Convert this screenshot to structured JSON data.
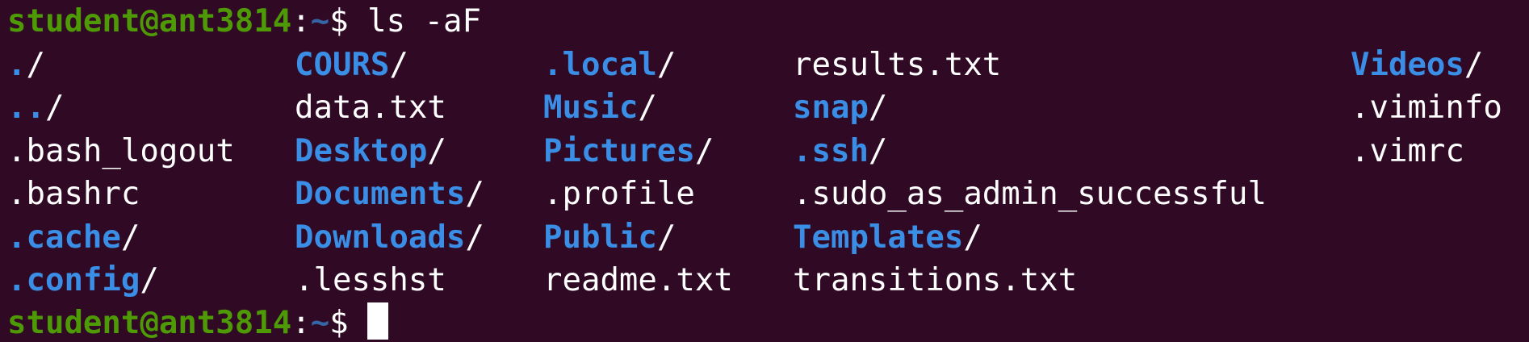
{
  "colors": {
    "background": "#300a24",
    "user_host": "#4e9a06",
    "path": "#3465a4",
    "directory": "#3a8ee6",
    "text": "#ffffff"
  },
  "prompt1": {
    "user_host": "student@ant3814",
    "sep": ":",
    "path": "~",
    "symbol": "$ ",
    "command": "ls -aF"
  },
  "listing": {
    "rows": [
      [
        {
          "name": ".",
          "suffix": "/",
          "type": "dir"
        },
        {
          "name": "COURS",
          "suffix": "/",
          "type": "dir"
        },
        {
          "name": ".local",
          "suffix": "/",
          "type": "dir"
        },
        {
          "name": "results.txt",
          "suffix": "",
          "type": "file"
        },
        {
          "name": "Videos",
          "suffix": "/",
          "type": "dir"
        }
      ],
      [
        {
          "name": "..",
          "suffix": "/",
          "type": "dir"
        },
        {
          "name": "data.txt",
          "suffix": "",
          "type": "file"
        },
        {
          "name": "Music",
          "suffix": "/",
          "type": "dir"
        },
        {
          "name": "snap",
          "suffix": "/",
          "type": "dir"
        },
        {
          "name": ".viminfo",
          "suffix": "",
          "type": "file"
        }
      ],
      [
        {
          "name": ".bash_logout",
          "suffix": "",
          "type": "file"
        },
        {
          "name": "Desktop",
          "suffix": "/",
          "type": "dir"
        },
        {
          "name": "Pictures",
          "suffix": "/",
          "type": "dir"
        },
        {
          "name": ".ssh",
          "suffix": "/",
          "type": "dir"
        },
        {
          "name": ".vimrc",
          "suffix": "",
          "type": "file"
        }
      ],
      [
        {
          "name": ".bashrc",
          "suffix": "",
          "type": "file"
        },
        {
          "name": "Documents",
          "suffix": "/",
          "type": "dir"
        },
        {
          "name": ".profile",
          "suffix": "",
          "type": "file"
        },
        {
          "name": ".sudo_as_admin_successful",
          "suffix": "",
          "type": "file"
        },
        null
      ],
      [
        {
          "name": ".cache",
          "suffix": "/",
          "type": "dir"
        },
        {
          "name": "Downloads",
          "suffix": "/",
          "type": "dir"
        },
        {
          "name": "Public",
          "suffix": "/",
          "type": "dir"
        },
        {
          "name": "Templates",
          "suffix": "/",
          "type": "dir"
        },
        null
      ],
      [
        {
          "name": ".config",
          "suffix": "/",
          "type": "dir"
        },
        {
          "name": ".lesshst",
          "suffix": "",
          "type": "file"
        },
        {
          "name": "readme.txt",
          "suffix": "",
          "type": "file"
        },
        {
          "name": "transitions.txt",
          "suffix": "",
          "type": "file"
        },
        null
      ]
    ]
  },
  "prompt2": {
    "user_host": "student@ant3814",
    "sep": ":",
    "path": "~",
    "symbol": "$ ",
    "command": ""
  }
}
